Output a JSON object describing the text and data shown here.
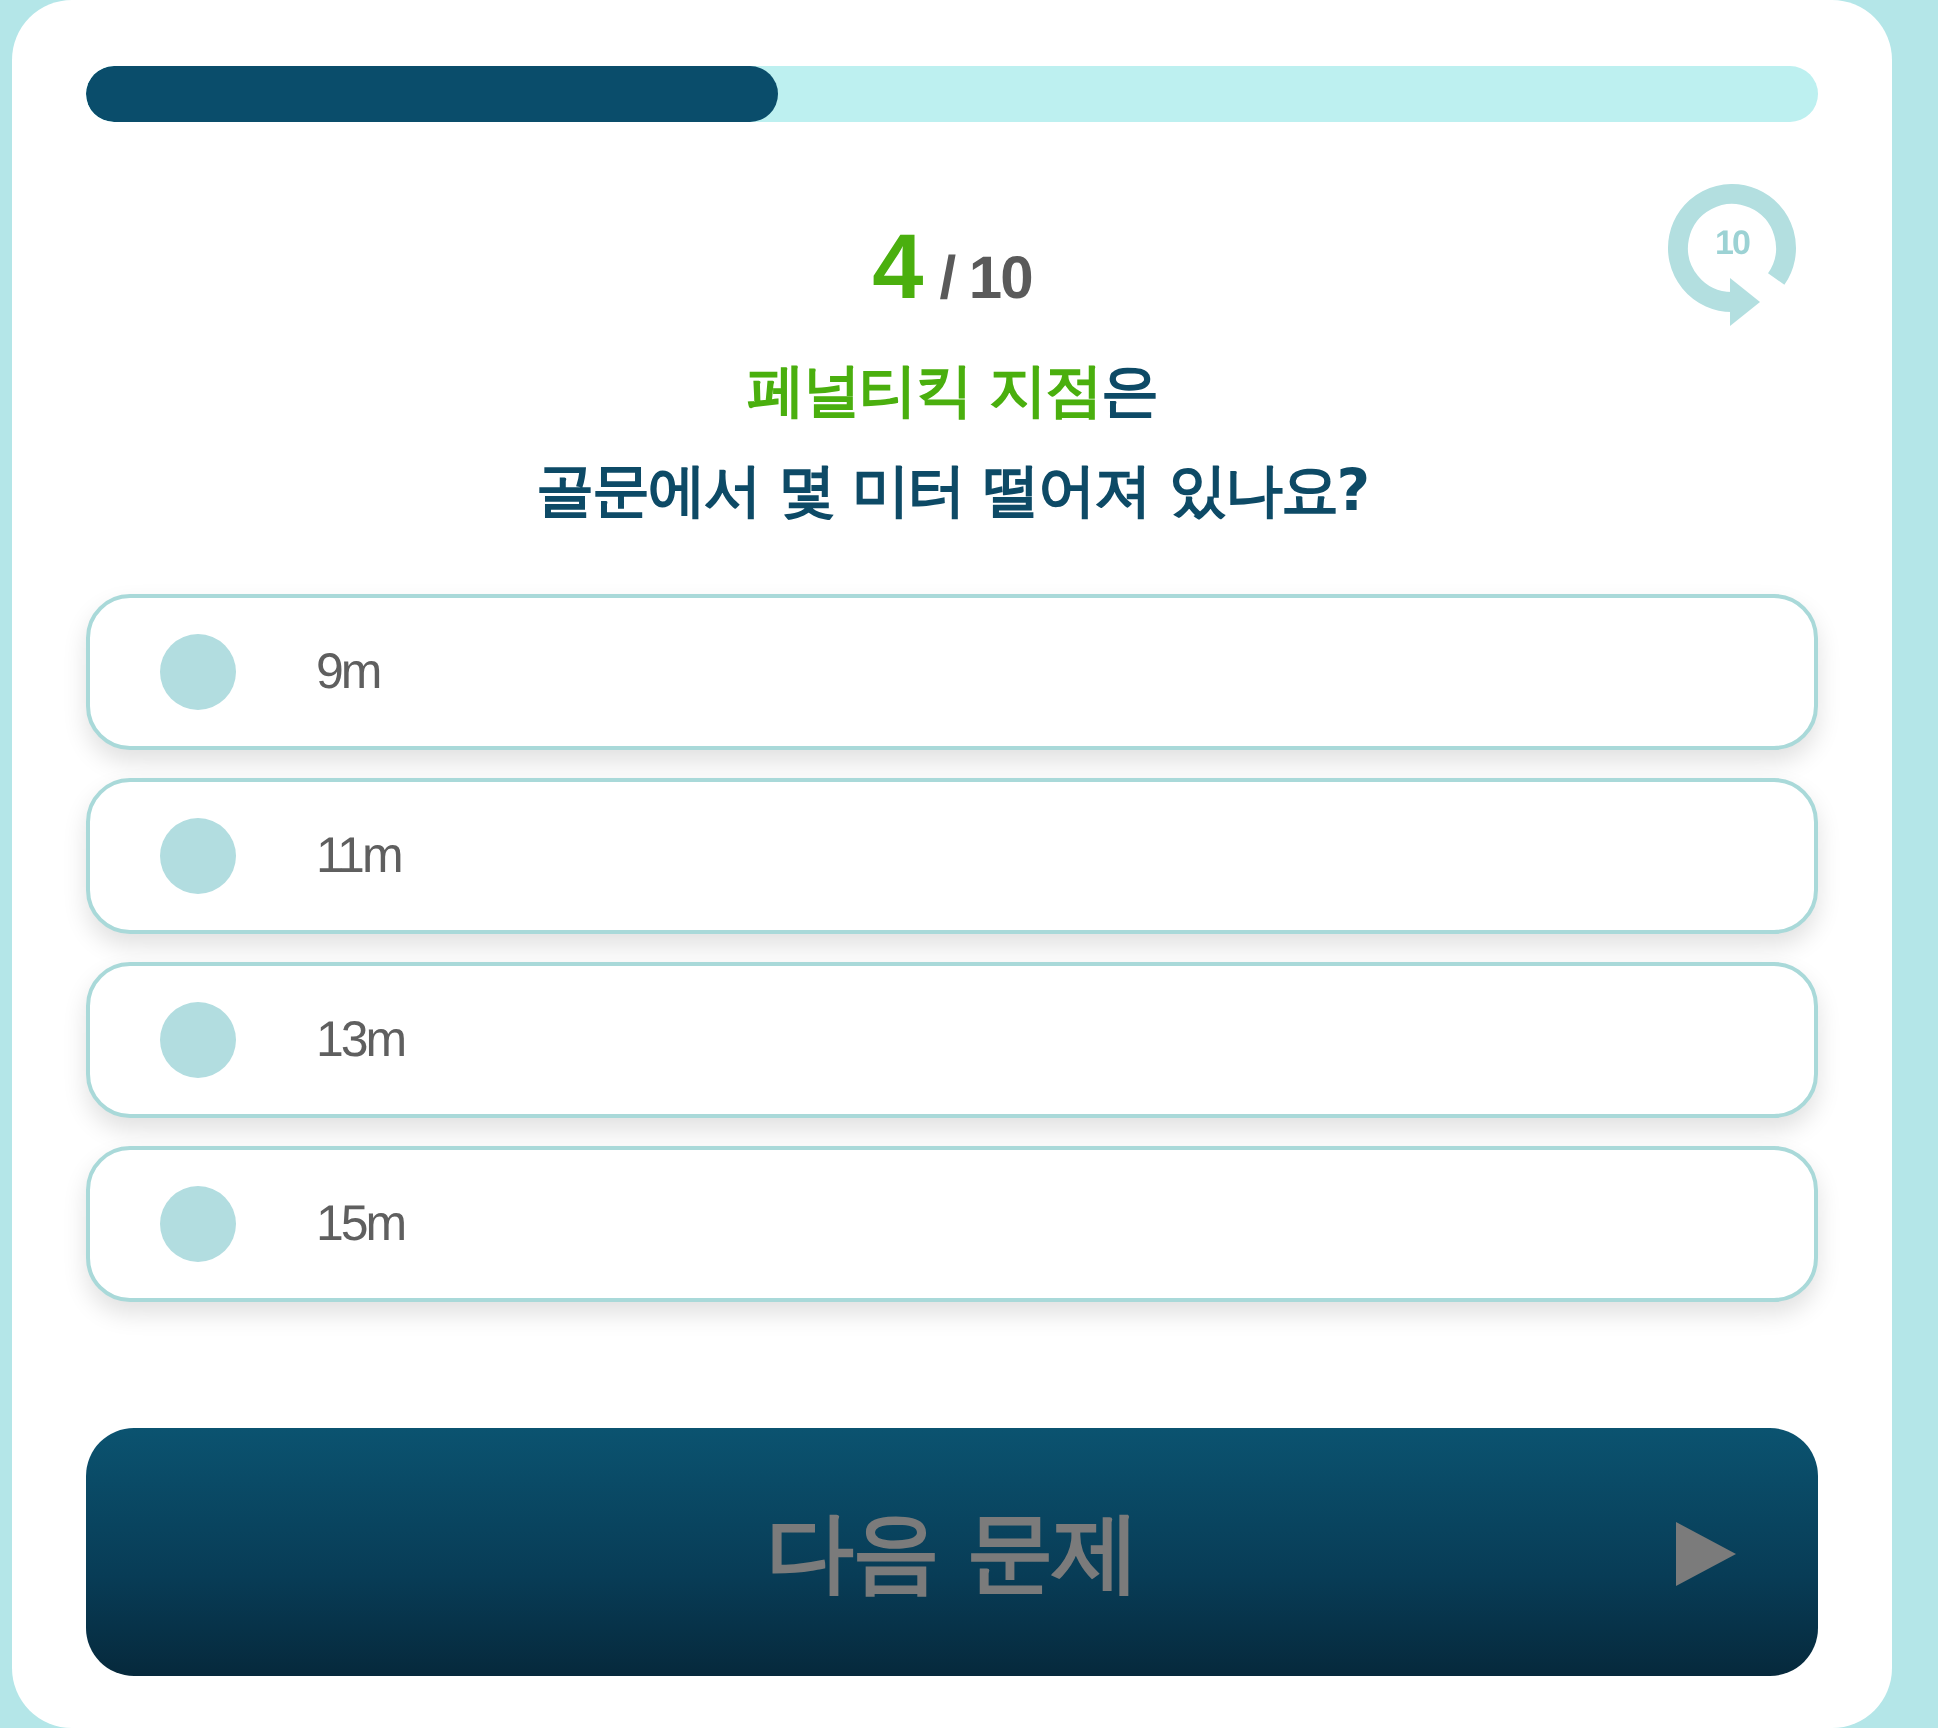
{
  "progress": {
    "level": 0.4
  },
  "counter": {
    "current": "4",
    "total": "/ 10"
  },
  "timer": {
    "count": "10"
  },
  "question": {
    "lines": [
      [
        {
          "text": "페널티킥 지점",
          "highlight": true
        },
        {
          "text": "은",
          "highlight": false
        }
      ],
      [
        {
          "text": "골문에서 몇 미터 떨어져 있나요?",
          "highlight": false
        }
      ]
    ]
  },
  "options": [
    {
      "label": "9m",
      "selected": false
    },
    {
      "label": "11m",
      "selected": false
    },
    {
      "label": "13m",
      "selected": false
    },
    {
      "label": "15m",
      "selected": false
    }
  ],
  "next_button": {
    "label": "다음 문제",
    "disabled": true
  }
}
